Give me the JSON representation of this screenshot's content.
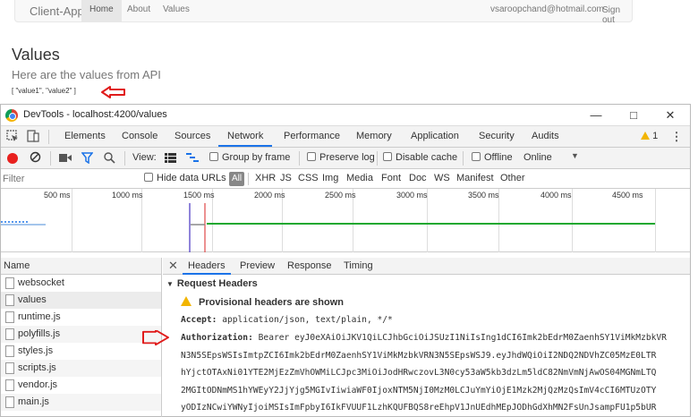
{
  "app": {
    "brand": "Client-App",
    "nav": [
      "Home",
      "About",
      "Values"
    ],
    "email": "vsaroopchand@hotmail.com",
    "signout": "Sign out",
    "title": "Values",
    "subtitle": "Here are the values from API",
    "values": "[ \"value1\", \"value2\" ]"
  },
  "devtools": {
    "title": "DevTools - localhost:4200/values",
    "tabs": [
      "Elements",
      "Console",
      "Sources",
      "Network",
      "Performance",
      "Memory",
      "Application",
      "Security",
      "Audits"
    ],
    "warning_count": "1",
    "toolbar": {
      "view_label": "View:",
      "group_by_frame": "Group by frame",
      "preserve_log": "Preserve log",
      "disable_cache": "Disable cache",
      "offline": "Offline",
      "throttle": "Online"
    },
    "filter": {
      "placeholder": "Filter",
      "hide_data_urls": "Hide data URLs",
      "all": "All",
      "types": [
        "XHR",
        "JS",
        "CSS",
        "Img",
        "Media",
        "Font",
        "Doc",
        "WS",
        "Manifest",
        "Other"
      ]
    },
    "timeline_ticks": [
      "500 ms",
      "1000 ms",
      "1500 ms",
      "2000 ms",
      "2500 ms",
      "3000 ms",
      "3500 ms",
      "4000 ms",
      "4500 ms"
    ],
    "name_header": "Name",
    "requests": [
      "websocket",
      "values",
      "runtime.js",
      "polyfills.js",
      "styles.js",
      "scripts.js",
      "vendor.js",
      "main.js"
    ],
    "detail_tabs": [
      "Headers",
      "Preview",
      "Response",
      "Timing"
    ],
    "section": "Request Headers",
    "provisional": "Provisional headers are shown",
    "accept_key": "Accept:",
    "accept_val": "application/json, text/plain, */*",
    "auth_key": "Authorization:",
    "auth_val": "Bearer eyJ0eXAiOiJKV1QiLCJhbGciOiJSUzI1NiIsIng1dCI6Imk2bEdrM0ZaenhSY1ViMkMzbkVR",
    "token_lines": [
      "N3N5SEpsWSIsImtpZCI6Imk2bEdrM0ZaenhSY1ViMkMzbkVRN3N5SEpsWSJ9.eyJhdWQiOiI2NDQ2NDVhZC05MzE0LTR",
      "hYjctOTAxNi01YTE2MjEzZmVhOWMiLCJpc3MiOiJodHRwczovL3N0cy53aW5kb3dzLm5ldC82NmVmNjAwOS04MGNmLTQ",
      "2MGItODNmMS1hYWEyY2JjYjg5MGIvIiwiaWF0IjoxNTM5NjI0MzM0LCJuYmYiOjE1Mzk2MjQzMzQsImV4cCI6MTUzOTY",
      "yODIzNCwiYWNyIjoiMSIsImFpbyI6IkFVUUF1LzhKQUFBQS8reEhpV1JnUEdhMEpJODhGdXhMN2FsUnJsampFU1p5bUR"
    ]
  }
}
